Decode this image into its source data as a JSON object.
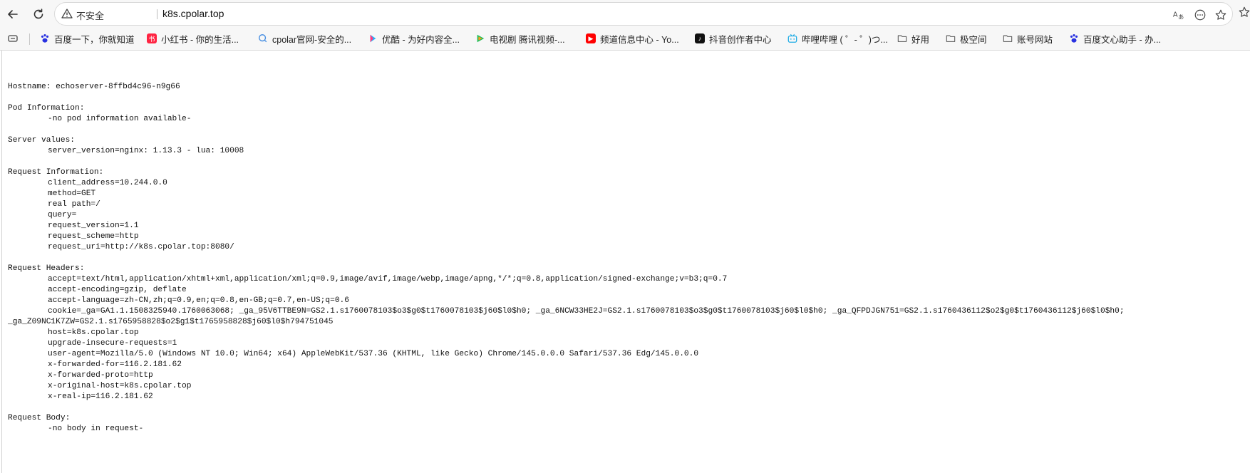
{
  "browser": {
    "insecure_label": "不安全",
    "url": "k8s.cpolar.top",
    "bookmarks": [
      {
        "label": "百度一下，你就知道",
        "icon": "baidu-paw-icon",
        "color": "#2932e1"
      },
      {
        "label": "小红书 - 你的生活...",
        "icon": "xiaohongshu-icon",
        "color": "#ff2442"
      },
      {
        "label": "cpolar官网-安全的...",
        "icon": "cpolar-icon",
        "color": "#4a90e2"
      },
      {
        "label": "优酷 - 为好内容全...",
        "icon": "youku-icon",
        "color": "#1eb4ff"
      },
      {
        "label": "电视剧 腾讯视频-...",
        "icon": "tencent-video-icon",
        "color": "#20c05c"
      },
      {
        "label": "频道信息中心 - Yo...",
        "icon": "youtube-icon",
        "color": "#ff0000"
      },
      {
        "label": "抖音创作者中心",
        "icon": "douyin-icon",
        "color": "#111111"
      },
      {
        "label": "哔哩哔哩 ( ゜- ゜)つ...",
        "icon": "bilibili-icon",
        "color": "#23ade5"
      },
      {
        "label": "好用",
        "icon": "folder-icon",
        "color": "#555555"
      },
      {
        "label": "极空间",
        "icon": "folder-icon",
        "color": "#555555"
      },
      {
        "label": "账号网站",
        "icon": "folder-icon",
        "color": "#555555"
      },
      {
        "label": "百度文心助手 - 办...",
        "icon": "baidu-paw-icon",
        "color": "#2932e1"
      }
    ]
  },
  "page": {
    "hostname": "Hostname: echoserver-8ffbd4c96-n9g66",
    "pod_title": "Pod Information:",
    "pod_value": "-no pod information available-",
    "server_title": "Server values:",
    "server_value": "server_version=nginx: 1.13.3 - lua: 10008",
    "request_info_title": "Request Information:",
    "request_info": [
      "client_address=10.244.0.0",
      "method=GET",
      "real path=/",
      "query=",
      "request_version=1.1",
      "request_scheme=http",
      "request_uri=http://k8s.cpolar.top:8080/"
    ],
    "headers_title": "Request Headers:",
    "headers": [
      "accept=text/html,application/xhtml+xml,application/xml;q=0.9,image/avif,image/webp,image/apng,*/*;q=0.8,application/signed-exchange;v=b3;q=0.7",
      "accept-encoding=gzip, deflate",
      "accept-language=zh-CN,zh;q=0.9,en;q=0.8,en-GB;q=0.7,en-US;q=0.6",
      "cookie=_ga=GA1.1.1508325940.1760063068; _ga_95V6TTBE9N=GS2.1.s1760078103$o3$g0$t1760078103$j60$l0$h0; _ga_6NCW33HE2J=GS2.1.s1760078103$o3$g0$t1760078103$j60$l0$h0; _ga_QFPDJGN751=GS2.1.s1760436112$o2$g0$t1760436112$j60$l0$h0;"
    ],
    "cookie_wrap": "_ga_Z09NC1K7ZW=GS2.1.s1765958828$o2$g1$t1765958828$j60$l0$h794751045",
    "headers_after": [
      "host=k8s.cpolar.top",
      "upgrade-insecure-requests=1",
      "user-agent=Mozilla/5.0 (Windows NT 10.0; Win64; x64) AppleWebKit/537.36 (KHTML, like Gecko) Chrome/145.0.0.0 Safari/537.36 Edg/145.0.0.0",
      "x-forwarded-for=116.2.181.62",
      "x-forwarded-proto=http",
      "x-original-host=k8s.cpolar.top",
      "x-real-ip=116.2.181.62"
    ],
    "body_title": "Request Body:",
    "body_value": "-no body in request-"
  }
}
